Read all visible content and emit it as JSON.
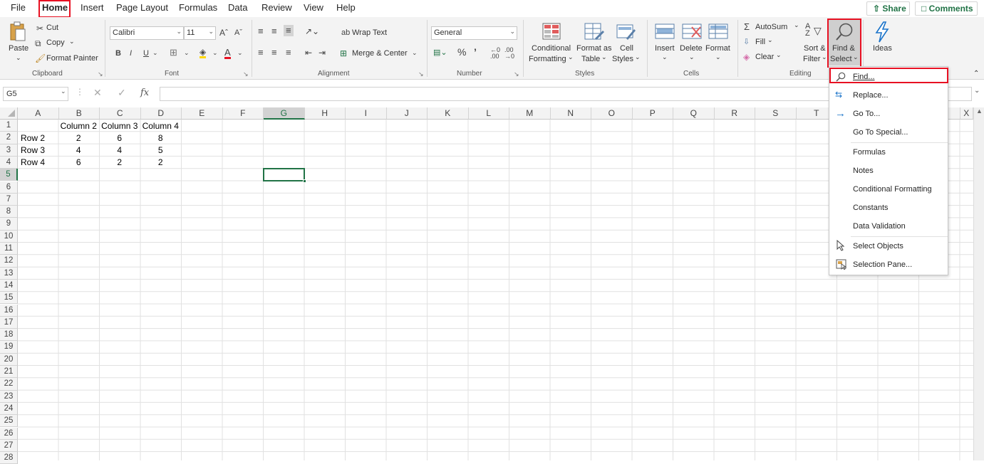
{
  "menu_tabs": [
    "File",
    "Home",
    "Insert",
    "Page Layout",
    "Formulas",
    "Data",
    "Review",
    "View",
    "Help"
  ],
  "share_label": "Share",
  "comments_label": "Comments",
  "clipboard": {
    "paste": "Paste",
    "cut": "Cut",
    "copy": "Copy",
    "format_painter": "Format Painter",
    "group": "Clipboard"
  },
  "font": {
    "name": "Calibri",
    "size": "11",
    "group": "Font"
  },
  "alignment": {
    "wrap_text": "Wrap Text",
    "merge_center": "Merge & Center",
    "group": "Alignment"
  },
  "number": {
    "format": "General",
    "group": "Number"
  },
  "styles": {
    "conditional_line1": "Conditional",
    "conditional_line2": "Formatting",
    "format_table_line1": "Format as",
    "format_table_line2": "Table",
    "cell_styles_line1": "Cell",
    "cell_styles_line2": "Styles",
    "group": "Styles"
  },
  "cells": {
    "insert": "Insert",
    "delete": "Delete",
    "format": "Format",
    "group": "Cells"
  },
  "editing": {
    "autosum": "AutoSum",
    "fill": "Fill",
    "clear": "Clear",
    "sort_line1": "Sort &",
    "sort_line2": "Filter",
    "find_line1": "Find &",
    "find_line2": "Select",
    "group": "Editing"
  },
  "ideas": "Ideas",
  "formula_bar": {
    "name_box": "G5",
    "fx": "fx",
    "content": ""
  },
  "columns": [
    "A",
    "B",
    "C",
    "D",
    "E",
    "F",
    "G",
    "H",
    "I",
    "J",
    "K",
    "L",
    "M",
    "N",
    "O",
    "P",
    "Q",
    "R",
    "S",
    "T",
    "U",
    "V",
    "W",
    "X"
  ],
  "row_numbers": [
    "1",
    "2",
    "3",
    "4",
    "5",
    "6",
    "7",
    "8",
    "9",
    "10",
    "11",
    "12",
    "13",
    "14",
    "15",
    "16",
    "17",
    "18",
    "19",
    "20",
    "21",
    "22",
    "23",
    "24",
    "25",
    "26",
    "27",
    "28"
  ],
  "sheet_data": {
    "headers": [
      "",
      "Column 2",
      "Column 3",
      "Column 4"
    ],
    "rows": [
      [
        "Row 2",
        "2",
        "6",
        "8"
      ],
      [
        "Row 3",
        "4",
        "4",
        "5"
      ],
      [
        "Row 4",
        "6",
        "2",
        "2"
      ]
    ]
  },
  "find_select_menu": [
    "Find...",
    "Replace...",
    "Go To...",
    "Go To Special...",
    "Formulas",
    "Notes",
    "Conditional Formatting",
    "Constants",
    "Data Validation",
    "Select Objects",
    "Selection Pane..."
  ],
  "colors": {
    "accent_green": "#217346",
    "highlight_red": "#e81123",
    "selection_green": "#217346"
  }
}
